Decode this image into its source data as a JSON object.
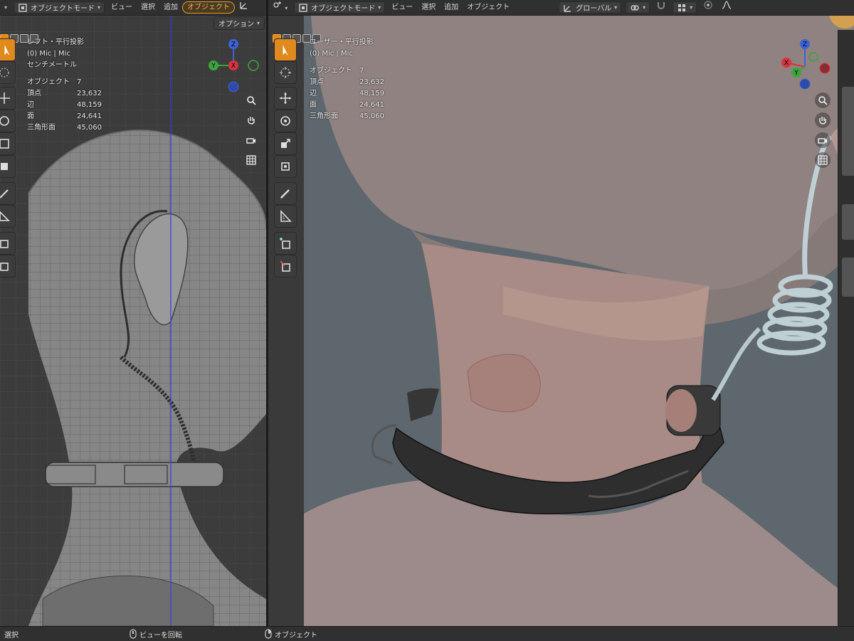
{
  "left_header": {
    "mode_label": "オブジェクトモード",
    "menu": [
      "ビュー",
      "選択",
      "追加"
    ],
    "active_menu": "オブジェクト",
    "option_label": "オプション"
  },
  "right_header": {
    "mode_label": "オブジェクトモード",
    "menu": [
      "ビュー",
      "選択",
      "追加",
      "オブジェクト"
    ],
    "transform_label": "グローバル"
  },
  "left_view": {
    "projection": "レフト・平行投影",
    "collection": "(0) Mic | Mic",
    "units": "センチメートル",
    "stats": [
      {
        "label": "オブジェクト",
        "value": "7"
      },
      {
        "label": "頂点",
        "value": "23,632"
      },
      {
        "label": "辺",
        "value": "48,159"
      },
      {
        "label": "面",
        "value": "24,641"
      },
      {
        "label": "三角形面",
        "value": "45,060"
      }
    ]
  },
  "right_view": {
    "projection": "ユーザー・平行投影",
    "collection": "(0) Mic | Mic",
    "stats": [
      {
        "label": "オブジェクト",
        "value": "7"
      },
      {
        "label": "頂点",
        "value": "23,632"
      },
      {
        "label": "辺",
        "value": "48,159"
      },
      {
        "label": "面",
        "value": "24,641"
      },
      {
        "label": "三角形面",
        "value": "45,060"
      }
    ]
  },
  "gizmo_axes": {
    "x": "X",
    "y": "Y",
    "z": "Z"
  },
  "status_bar": {
    "select_label": "選択",
    "rotate_label": "ビューを回転",
    "object_label": "オブジェクト"
  },
  "colors": {
    "header": "#303030",
    "active_accent": "#e0891d",
    "axis_x": "#d8343f",
    "axis_y": "#3ea33e",
    "axis_z": "#3d63d6",
    "left_viewport_bg": "#3c3c3c",
    "right_viewport_bg": "#5d676d"
  }
}
